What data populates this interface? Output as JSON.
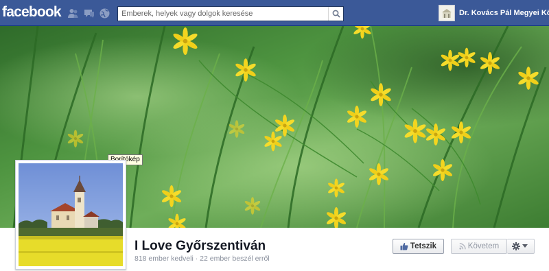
{
  "topbar": {
    "logo": "facebook",
    "jewels": [
      "friend-requests-icon",
      "messages-icon",
      "notifications-icon"
    ],
    "search_placeholder": "Emberek, helyek vagy dolgok keresése",
    "user_name": "Dr. Kovács Pál Megyei Kö"
  },
  "cover": {
    "tooltip": "Borítókép"
  },
  "page": {
    "name": "I Love Győrszentiván",
    "stats": "818 ember kedveli · 22 ember beszél erről"
  },
  "actions": {
    "like_label": "Tetszik",
    "follow_label": "Követem",
    "settings_icon": "gear-icon"
  },
  "colors": {
    "brand_blue": "#3b5998",
    "flower_yellow": "#f3d51f",
    "grass_green": "#4a8a36"
  }
}
